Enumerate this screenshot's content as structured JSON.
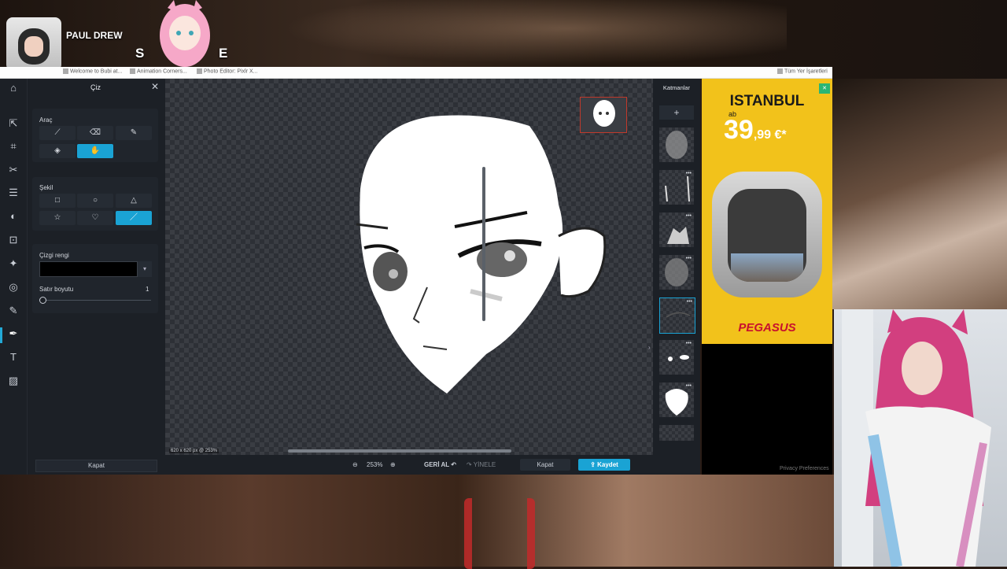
{
  "stream": {
    "streamer_name": "PAUL DREW",
    "overlay_text_left": "S",
    "overlay_text_right": "E"
  },
  "browser": {
    "bookmarks": [
      {
        "label": "Welcome to Bubi at..."
      },
      {
        "label": "Animation Corners..."
      },
      {
        "label": "Photo Editor: Pixlr X..."
      }
    ],
    "all_bookmarks": "Tüm Yer İşaretleri"
  },
  "editor": {
    "panel_title": "Çiz",
    "tools_label": "Araç",
    "shape_label": "Şekil",
    "line_color_label": "Çizgi rengi",
    "line_color": "#000000",
    "line_size_label": "Satır boyutu",
    "line_size_value": "1",
    "line_size_fraction": 0.0,
    "panel_close": "Kapat",
    "canvas_info": "620 x 620 px @ 253%",
    "zoom": "253%",
    "undo": "GERİ AL",
    "redo": "YİNELE",
    "close": "Kapat",
    "save": "Kaydet",
    "layers_title": "Katmanlar",
    "accent": "#1aa3d4"
  },
  "ad": {
    "city": "ISTANBUL",
    "from": "ab",
    "price_whole": "39",
    "price_fraction": ",99 €*",
    "brand": "PEGASUS",
    "privacy": "Privacy Preferences"
  }
}
